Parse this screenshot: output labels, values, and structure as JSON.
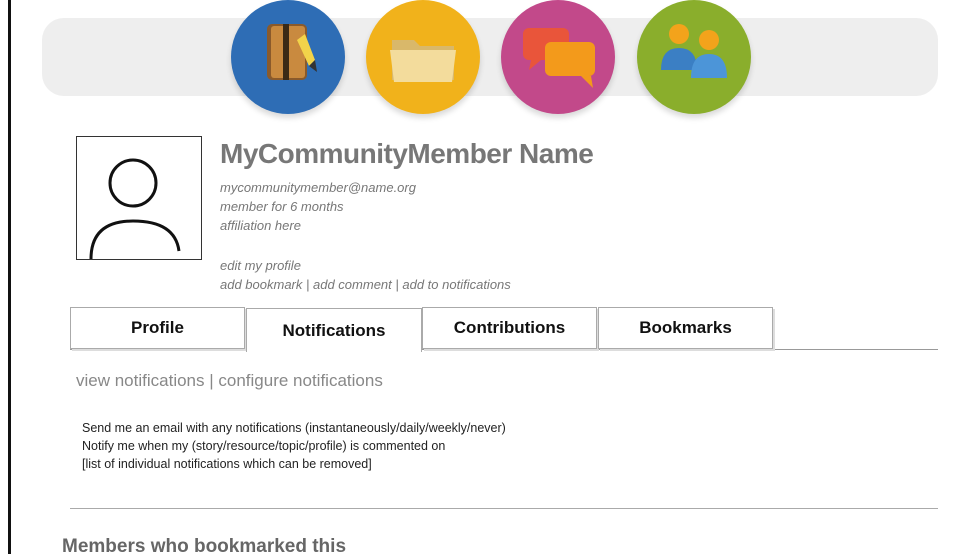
{
  "nav": {
    "items": [
      {
        "name": "notebook",
        "color": "#2e6db5"
      },
      {
        "name": "folder",
        "color": "#f1b21b"
      },
      {
        "name": "chat",
        "color": "#c2498a"
      },
      {
        "name": "people",
        "color": "#8aae2c"
      }
    ]
  },
  "profile": {
    "name": "MyCommunityMember Name",
    "email": "mycommunitymember@name.org",
    "tenure": "member for 6 months",
    "affiliation": "affiliation here",
    "edit_link": "edit my profile",
    "actions": {
      "add_bookmark": "add bookmark",
      "add_comment": "add comment",
      "add_to_notifications": "add to notifications",
      "separator": " | "
    }
  },
  "tabs": [
    {
      "label": "Profile",
      "active": false
    },
    {
      "label": "Notifications",
      "active": true
    },
    {
      "label": "Contributions",
      "active": false
    },
    {
      "label": "Bookmarks",
      "active": false
    }
  ],
  "subnav": {
    "view": "view notifications",
    "separator": " | ",
    "configure": "configure notifications"
  },
  "notification_settings": [
    "Send me an email with any notifications (instantaneously/daily/weekly/never)",
    "Notify me when my (story/resource/topic/profile) is commented on",
    "[list of individual notifications which can be removed]"
  ],
  "members_section": {
    "title": "Members who bookmarked this"
  }
}
